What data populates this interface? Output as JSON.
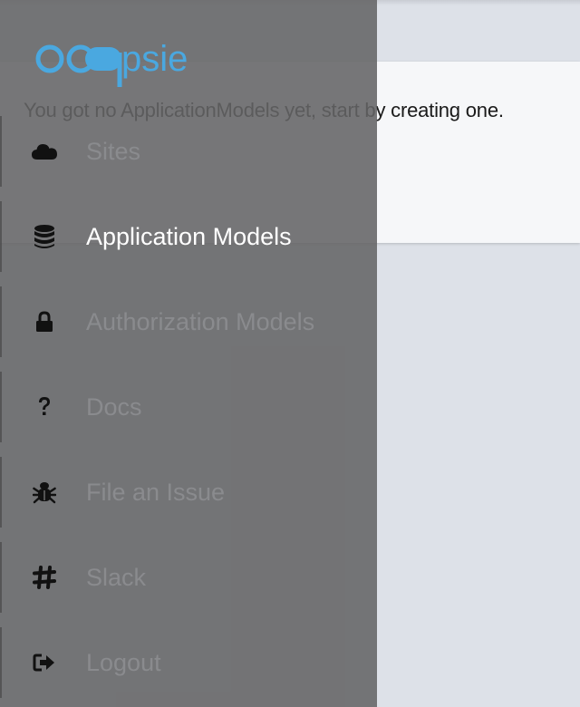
{
  "app": {
    "logo_text": "oopsie",
    "brand_color": "#4aa8e0"
  },
  "main": {
    "empty_message": "You got no ApplicationModels yet, start by creating one."
  },
  "sidebar": {
    "items": [
      {
        "label": "Sites",
        "icon": "cloud-icon",
        "active": false
      },
      {
        "label": "Application Models",
        "icon": "database-icon",
        "active": true
      },
      {
        "label": "Authorization Models",
        "icon": "lock-icon",
        "active": false
      },
      {
        "label": "Docs",
        "icon": "question-icon",
        "active": false
      },
      {
        "label": "File an Issue",
        "icon": "bug-icon",
        "active": false
      },
      {
        "label": "Slack",
        "icon": "slack-hash-icon",
        "active": false
      },
      {
        "label": "Logout",
        "icon": "logout-icon",
        "active": false
      }
    ]
  }
}
